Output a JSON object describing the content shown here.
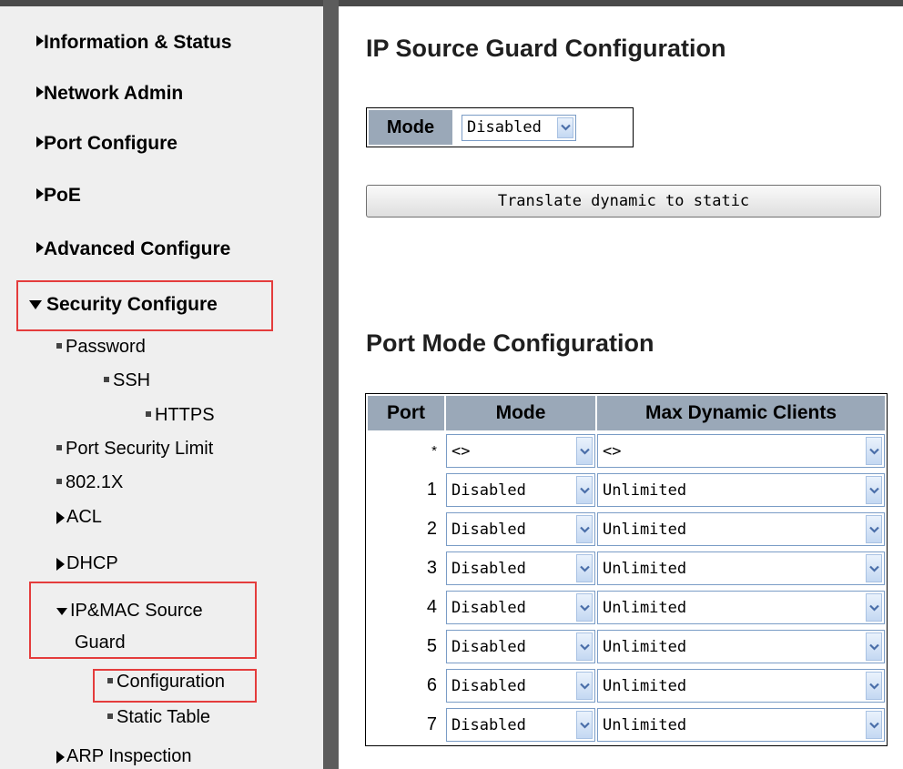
{
  "sidebar": {
    "info_status": "Information & Status",
    "network_admin": "Network Admin",
    "port_configure": "Port Configure",
    "poe": "PoE",
    "advanced_configure": "Advanced Configure",
    "security_configure": "Security Configure",
    "password": "Password",
    "ssh": "SSH",
    "https": "HTTPS",
    "port_security_limit": "Port Security Limit",
    "dot1x": "802.1X",
    "acl": "ACL",
    "dhcp": "DHCP",
    "ip_mac_source_guard_line1": "IP&MAC Source",
    "ip_mac_source_guard_line2": "Guard",
    "configuration": "Configuration",
    "static_table": "Static Table",
    "arp_inspection": "ARP Inspection"
  },
  "main": {
    "title": "IP Source Guard Configuration",
    "mode_label": "Mode",
    "mode_value": "Disabled",
    "translate_button": "Translate dynamic to static",
    "port_mode_title": "Port Mode Configuration",
    "table": {
      "headers": [
        "Port",
        "Mode",
        "Max Dynamic Clients"
      ],
      "rows": [
        {
          "port": "*",
          "mode": "<>",
          "max": "<>"
        },
        {
          "port": "1",
          "mode": "Disabled",
          "max": "Unlimited"
        },
        {
          "port": "2",
          "mode": "Disabled",
          "max": "Unlimited"
        },
        {
          "port": "3",
          "mode": "Disabled",
          "max": "Unlimited"
        },
        {
          "port": "4",
          "mode": "Disabled",
          "max": "Unlimited"
        },
        {
          "port": "5",
          "mode": "Disabled",
          "max": "Unlimited"
        },
        {
          "port": "6",
          "mode": "Disabled",
          "max": "Unlimited"
        },
        {
          "port": "7",
          "mode": "Disabled",
          "max": "Unlimited"
        }
      ]
    }
  },
  "colors": {
    "header_bg": "#9aa8b8",
    "highlight_box": "#e43c3c",
    "sidebar_bg": "#efefef",
    "divider": "#5c5c5c"
  },
  "icons": {
    "collapsed": "triangle-right-icon",
    "expanded": "triangle-down-icon",
    "bullet": "square-bullet-icon",
    "dropdown": "chevron-down-icon"
  }
}
